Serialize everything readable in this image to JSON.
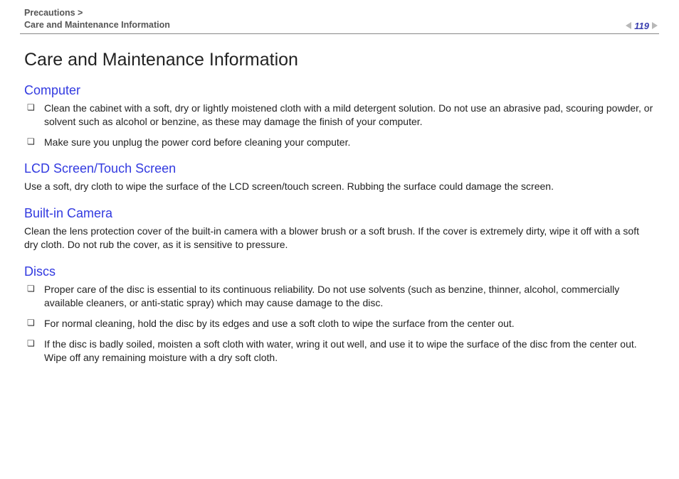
{
  "header": {
    "breadcrumb_parent": "Precautions >",
    "breadcrumb_current": "Care and Maintenance Information",
    "page_number": "119"
  },
  "title": "Care and Maintenance Information",
  "sections": {
    "computer": {
      "heading": "Computer",
      "items": [
        "Clean the cabinet with a soft, dry or lightly moistened cloth with a mild detergent solution. Do not use an abrasive pad, scouring powder, or solvent such as alcohol or benzine, as these may damage the finish of your computer.",
        "Make sure you unplug the power cord before cleaning your computer."
      ]
    },
    "lcd": {
      "heading": "LCD Screen/Touch Screen",
      "text": "Use a soft, dry cloth to wipe the surface of the LCD screen/touch screen. Rubbing the surface could damage the screen."
    },
    "camera": {
      "heading": "Built-in Camera",
      "text": "Clean the lens protection cover of the built-in camera with a blower brush or a soft brush. If the cover is extremely dirty, wipe it off with a soft dry cloth. Do not rub the cover, as it is sensitive to pressure."
    },
    "discs": {
      "heading": "Discs",
      "items": [
        "Proper care of the disc is essential to its continuous reliability. Do not use solvents (such as benzine, thinner, alcohol, commercially available cleaners, or anti-static spray) which may cause damage to the disc.",
        "For normal cleaning, hold the disc by its edges and use a soft cloth to wipe the surface from the center out.",
        "If the disc is badly soiled, moisten a soft cloth with water, wring it out well, and use it to wipe the surface of the disc from the center out. Wipe off any remaining moisture with a dry soft cloth."
      ]
    }
  }
}
